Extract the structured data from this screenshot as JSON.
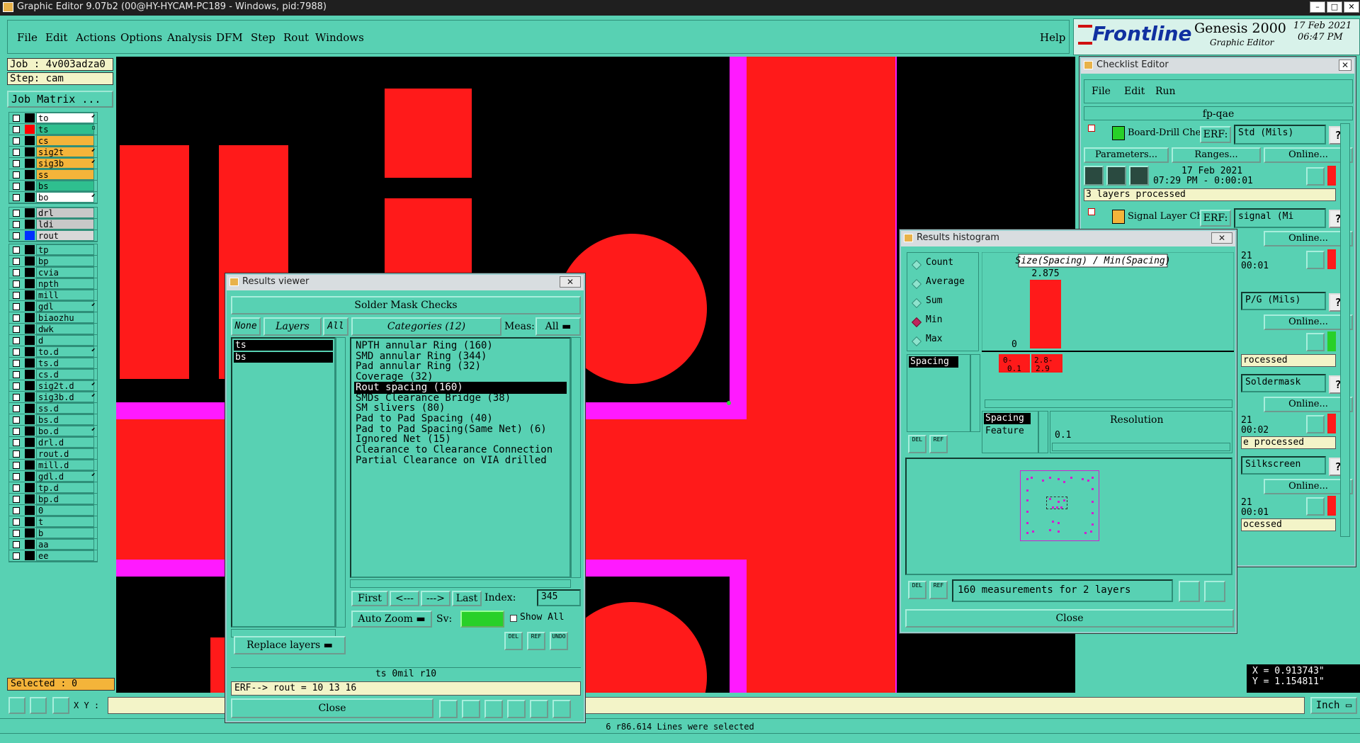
{
  "window": {
    "title": "Graphic Editor 9.07b2 (00@HY-HYCAM-PC189 - Windows, pid:7988)"
  },
  "menu": [
    "File",
    "Edit",
    "Actions",
    "Options",
    "Analysis",
    "DFM",
    "Step",
    "Rout",
    "Windows"
  ],
  "help": "Help",
  "logo": {
    "brand": "Frontline",
    "product": "Genesis 2000",
    "subtitle": "Graphic Editor",
    "date": "17 Feb 2021",
    "time": "06:47 PM"
  },
  "job": {
    "job_label": "Job : 4v003adza0",
    "step_label": "Step: cam",
    "matrix_button": "Job Matrix ..."
  },
  "layers_group1": [
    {
      "name": "to",
      "color": "#000000",
      "bg": "#ffffff",
      "mark": "⬋"
    },
    {
      "name": "ts",
      "color": "#ff0000",
      "bg": "#2fbf8f",
      "mark": "▫"
    },
    {
      "name": "cs",
      "color": "#000000",
      "bg": "#f4b43a",
      "mark": ""
    },
    {
      "name": "sig2t",
      "color": "#000000",
      "bg": "#f4b43a",
      "mark": "⬋"
    },
    {
      "name": "sig3b",
      "color": "#000000",
      "bg": "#f4b43a",
      "mark": "⬋"
    },
    {
      "name": "ss",
      "color": "#000000",
      "bg": "#f4b43a",
      "mark": ""
    },
    {
      "name": "bs",
      "color": "#000000",
      "bg": "#2fbf8f",
      "mark": ""
    },
    {
      "name": "bo",
      "color": "#000000",
      "bg": "#ffffff",
      "mark": "⬋"
    }
  ],
  "layers_group2": [
    {
      "name": "drl",
      "color": "#000000",
      "bg": "#c8c8c8",
      "mark": ""
    },
    {
      "name": "ldi",
      "color": "#000000",
      "bg": "#c8c8c8",
      "mark": ""
    },
    {
      "name": "rout",
      "color": "#0030ff",
      "bg": "#d8d8d8",
      "mark": ""
    }
  ],
  "layers_group3": [
    "tp",
    "bp",
    "cvia",
    "npth",
    "mill",
    "gdl",
    "biaozhu",
    "dwk",
    "d",
    "to.d",
    "ts.d",
    "cs.d",
    "sig2t.d",
    "sig3b.d",
    "ss.d",
    "bs.d",
    "bo.d",
    "drl.d",
    "rout.d",
    "mill.d",
    "gdl.d",
    "tp.d",
    "bp.d",
    "0",
    "t",
    "b",
    "aa",
    "ee"
  ],
  "layers_group3_marks": {
    "gdl": "⬋",
    "to.d": "⬋",
    "sig2t.d": "⬋",
    "sig3b.d": "⬋",
    "bo.d": "⬋",
    "gdl.d": "⬋"
  },
  "selected": "Selected : 0",
  "coords": {
    "x": "X = 0.913743\"",
    "y": "Y = 1.154811\""
  },
  "bottom": {
    "xy_label": "X Y :",
    "xy_value": "",
    "unit": "Inch",
    "status": "6 r86.614 Lines were selected"
  },
  "results_viewer": {
    "title": "Results viewer",
    "header": "Solder Mask Checks",
    "none_btn": "None",
    "layers_btn": "Layers",
    "all_btn": "All",
    "categories_btn": "Categories (12)",
    "meas_label": "Meas:",
    "meas_value": "All",
    "layers": [
      "ts",
      "bs"
    ],
    "categories": [
      "NPTH annular Ring (160)",
      "SMD annular Ring (344)",
      "Pad annular Ring (32)",
      "Coverage (32)",
      "Rout spacing (160)",
      "SMDs Clearance Bridge (38)",
      "SM slivers (80)",
      "Pad to Pad Spacing (40)",
      "Pad to Pad Spacing(Same Net) (6)",
      "Ignored Net (15)",
      "Clearance to Clearance Connection",
      "Partial Clearance on VIA drilled"
    ],
    "selected_category": 4,
    "first": "First",
    "prev": "<---",
    "next": "--->",
    "last": "Last",
    "index_label": "Index:",
    "index_value": "345",
    "auto_zoom": "Auto Zoom",
    "sv_label": "Sv:",
    "show_all": "Show All",
    "replace_layers": "Replace layers",
    "del": "DEL",
    "ref": "REF",
    "undo": "UNDO",
    "info": "ts 0mil  r10",
    "erf": "ERF--> rout = 10 13 16",
    "close": "Close"
  },
  "histogram": {
    "title": "Results histogram",
    "options": [
      "Count",
      "Average",
      "Sum",
      "Min",
      "Max"
    ],
    "selected_option": "Min",
    "list_item": "Spacing",
    "chart_title": "Size(Spacing) / Min(Spacing)",
    "bar_value": "2.875",
    "zero_label": "0",
    "bin1_label": "0-\n0.1",
    "bin2_label": "2.8-\n2.9",
    "spacing_label": "Spacing",
    "feature_label": "Feature",
    "resolution_label": "Resolution",
    "resolution_value": "0.1",
    "del": "DEL",
    "ref": "REF",
    "summary": "160 measurements for 2 layers",
    "close": "Close"
  },
  "checklist": {
    "title": "Checklist Editor",
    "menu": [
      "File",
      "Edit",
      "Run"
    ],
    "name": "fp-qae",
    "items": [
      {
        "name": "Board-Drill Che",
        "erf_label": "ERF:",
        "erf_value": "Std (Mils)",
        "date": "17 Feb 2021",
        "time": "07:29 PM - 0:00:01",
        "status": "3 layers processed"
      },
      {
        "name": "Signal Layer Ch",
        "erf_label": "ERF:",
        "erf_value": "signal (Mi",
        "date": "21",
        "time": "00:01",
        "status": ""
      }
    ],
    "partial": [
      {
        "erf": "P/G (Mils)",
        "date": "21",
        "time": "00:01",
        "status": "rocessed"
      },
      {
        "erf": "Soldermask",
        "date": "21",
        "time": "00:02",
        "status": "e processed"
      },
      {
        "erf": "Silkscreen",
        "date": "21",
        "time": "00:01",
        "status": "ocessed"
      }
    ],
    "parameters": "Parameters...",
    "ranges": "Ranges...",
    "online": "Online..."
  }
}
